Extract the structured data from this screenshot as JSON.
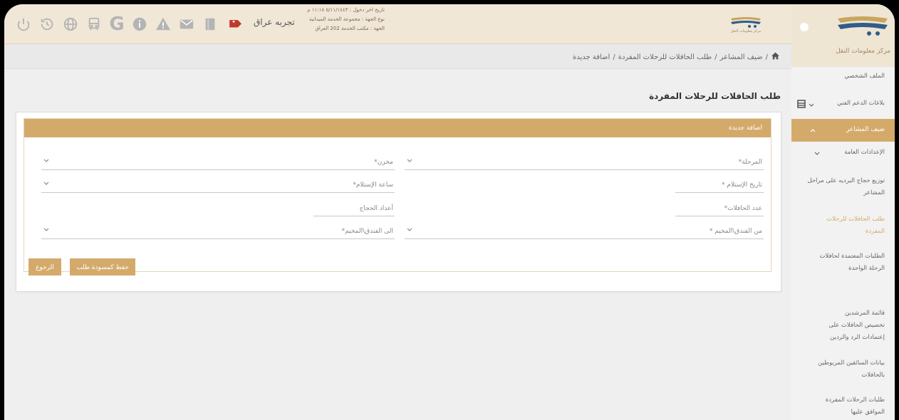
{
  "header": {
    "username": "تجربه عراق",
    "login_date": "تاريخ اخر دخول : ٥/١١/١٤٤٣ ١١:١٨ م",
    "entity_type": "نوع الجهة : مجموعة الخدمة الميدانية",
    "entity": "الجهة : مكتب الخدمة 202 العراق",
    "logo_caption": "مركز معلومات النقل",
    "icons": [
      "power-icon",
      "history-icon",
      "globe-icon",
      "bus-icon",
      "google-icon",
      "info-icon",
      "warning-icon",
      "mail-icon",
      "book-icon",
      "tag-icon"
    ]
  },
  "breadcrumb": {
    "items": [
      "ضيف المشاعر",
      "طلب الحافلات للرحلات المفردة",
      "اضافة جديدة"
    ],
    "separator": "/"
  },
  "page": {
    "title": "طلب الحافلات للرحلات المفردة"
  },
  "form": {
    "section_title": "اضافة جديدة",
    "fields": {
      "stage": "المرحلة*",
      "warehouse": "مخزن*",
      "receive_date": "تاريخ الإستلام *",
      "receive_time": "ساعة الإستلام*",
      "bus_count": "عدد الحافلات*",
      "pilgrims_count": "أعداد الحجاج",
      "from_hotel": "من الفندق\\المخيم *",
      "to_hotel": "الى الفندق\\المخيم*"
    },
    "buttons": {
      "save_draft": "حفظ كمسودة طلب",
      "back": "الرجوع"
    }
  },
  "sidebar": {
    "logo_caption": "مركز معلومات النقل",
    "items": [
      "الملف الشخصي",
      "بلاغات الدعم الفني",
      "ضيف المشاعر",
      "الإعدادات العامة",
      "توزيع حجاج البرديه على مراحل المشاعر",
      "طلب الحافلات للرحلات المفردة",
      "الطلبات المعتمدة لحافلات الرحلة الواحدة",
      "قائمة المرشدين",
      "تخصيص الحافلات على إعتمادات الرد والردين",
      "بيانات السائقين المربوطين بالحافلات",
      "طلبات الرحلات المفردة الموافق عليها"
    ]
  },
  "colors": {
    "accent": "#d4aa6b",
    "header_bg": "#f1e7d7",
    "active_red": "#c0392b"
  }
}
